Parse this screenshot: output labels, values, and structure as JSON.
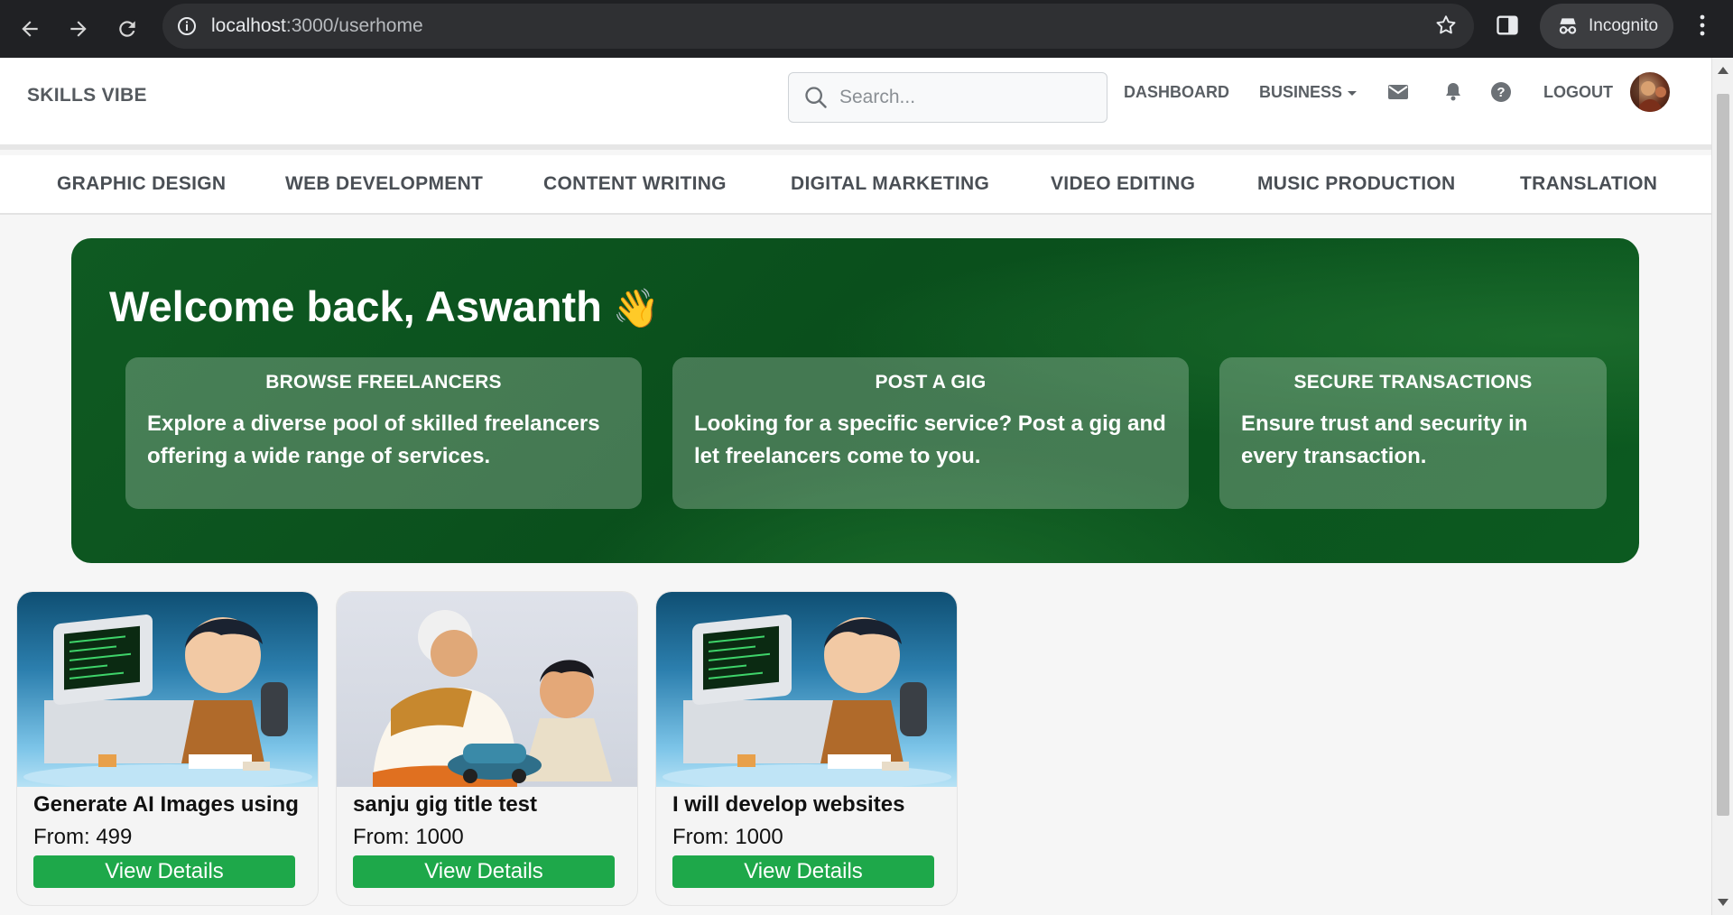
{
  "browser": {
    "url_host": "localhost",
    "url_path": ":3000/userhome",
    "incognito_label": "Incognito"
  },
  "header": {
    "logo": "SKILLS VIBE",
    "search_placeholder": "Search...",
    "nav": {
      "dashboard": "DASHBOARD",
      "business": "BUSINESS",
      "logout": "LOGOUT"
    }
  },
  "categories": [
    "GRAPHIC DESIGN",
    "WEB DEVELOPMENT",
    "CONTENT WRITING",
    "DIGITAL MARKETING",
    "VIDEO EDITING",
    "MUSIC PRODUCTION",
    "TRANSLATION"
  ],
  "hero": {
    "title": "Welcome back, Aswanth",
    "emoji": "👋",
    "features": [
      {
        "heading": "BROWSE FREELANCERS",
        "text": "Explore a diverse pool of skilled freelancers offering a wide range of services."
      },
      {
        "heading": "POST A GIG",
        "text": "Looking for a specific service? Post a gig and let freelancers come to you."
      },
      {
        "heading": "SECURE TRANSACTIONS",
        "text": "Ensure trust and security in every transaction."
      }
    ]
  },
  "gigs": [
    {
      "title": "Generate AI Images using",
      "price": "From: 499",
      "button": "View Details"
    },
    {
      "title": "sanju gig title test",
      "price": "From: 1000",
      "button": "View Details"
    },
    {
      "title": "I will develop websites",
      "price": "From: 1000",
      "button": "View Details"
    }
  ],
  "colors": {
    "hero_green": "#0c5520",
    "button_green": "#1ea84a",
    "chrome_dark": "#202124"
  }
}
